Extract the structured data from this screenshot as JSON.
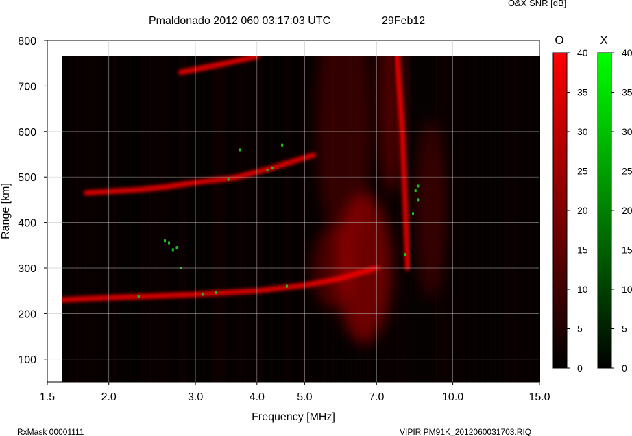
{
  "header": {
    "title": "Pmaldonado 2012 060 03:17:03 UTC",
    "date": "29Feb12",
    "colorbar_title": "O&X SNR [dB]"
  },
  "footer": {
    "left": "RxMask 00001111",
    "right": "VIPIR  PM91K_2012060031703.RIQ"
  },
  "chart_data": {
    "type": "heatmap",
    "title": "Pmaldonado 2012 060 03:17:03 UTC",
    "xlabel": "Frequency [MHz]",
    "ylabel": "Range [km]",
    "x_scale": "log",
    "xlim": [
      1.5,
      15.0
    ],
    "ylim": [
      50,
      800
    ],
    "x_ticks": [
      {
        "value": 1.5,
        "label": "1.5"
      },
      {
        "value": 2.0,
        "label": "2.0"
      },
      {
        "value": 3.0,
        "label": "3.0"
      },
      {
        "value": 4.0,
        "label": "4.0"
      },
      {
        "value": 5.0,
        "label": "5.0"
      },
      {
        "value": 7.0,
        "label": "7.0"
      },
      {
        "value": 10.0,
        "label": "10.0"
      },
      {
        "value": 15.0,
        "label": "15.0"
      }
    ],
    "y_ticks": [
      100,
      200,
      300,
      400,
      500,
      600,
      700,
      800
    ],
    "grid": true,
    "data_frequency_range": [
      1.6,
      15.0
    ],
    "data_range_top": 770,
    "traces": [
      {
        "name": "O",
        "color": "#ff0000",
        "points": [
          [
            1.6,
            230
          ],
          [
            2.0,
            235
          ],
          [
            2.4,
            238
          ],
          [
            3.0,
            242
          ],
          [
            4.0,
            250
          ],
          [
            5.0,
            262
          ],
          [
            5.8,
            275
          ],
          [
            6.5,
            290
          ],
          [
            7.0,
            300
          ]
        ]
      },
      {
        "name": "O",
        "color": "#ff0000",
        "points": [
          [
            1.8,
            465
          ],
          [
            2.3,
            472
          ],
          [
            2.6,
            478
          ],
          [
            3.0,
            488
          ],
          [
            3.6,
            498
          ],
          [
            4.3,
            520
          ],
          [
            5.2,
            548
          ]
        ]
      },
      {
        "name": "O",
        "color": "#ff0000",
        "points": [
          [
            2.8,
            730
          ],
          [
            3.4,
            748
          ],
          [
            4.0,
            765
          ]
        ]
      },
      {
        "name": "O",
        "color": "#ff0000",
        "points": [
          [
            7.7,
            770
          ],
          [
            7.9,
            600
          ],
          [
            8.0,
            450
          ],
          [
            8.1,
            300
          ]
        ]
      }
    ],
    "colorbars": [
      {
        "name": "O",
        "label": "O",
        "color": "#ff0000",
        "min": 0,
        "max": 40,
        "ticks": [
          0,
          5,
          10,
          15,
          20,
          25,
          30,
          35,
          40
        ]
      },
      {
        "name": "X",
        "label": "X",
        "color": "#00ff00",
        "min": 0,
        "max": 40,
        "ticks": [
          0,
          5,
          10,
          15,
          20,
          25,
          30,
          35,
          40
        ]
      }
    ]
  }
}
